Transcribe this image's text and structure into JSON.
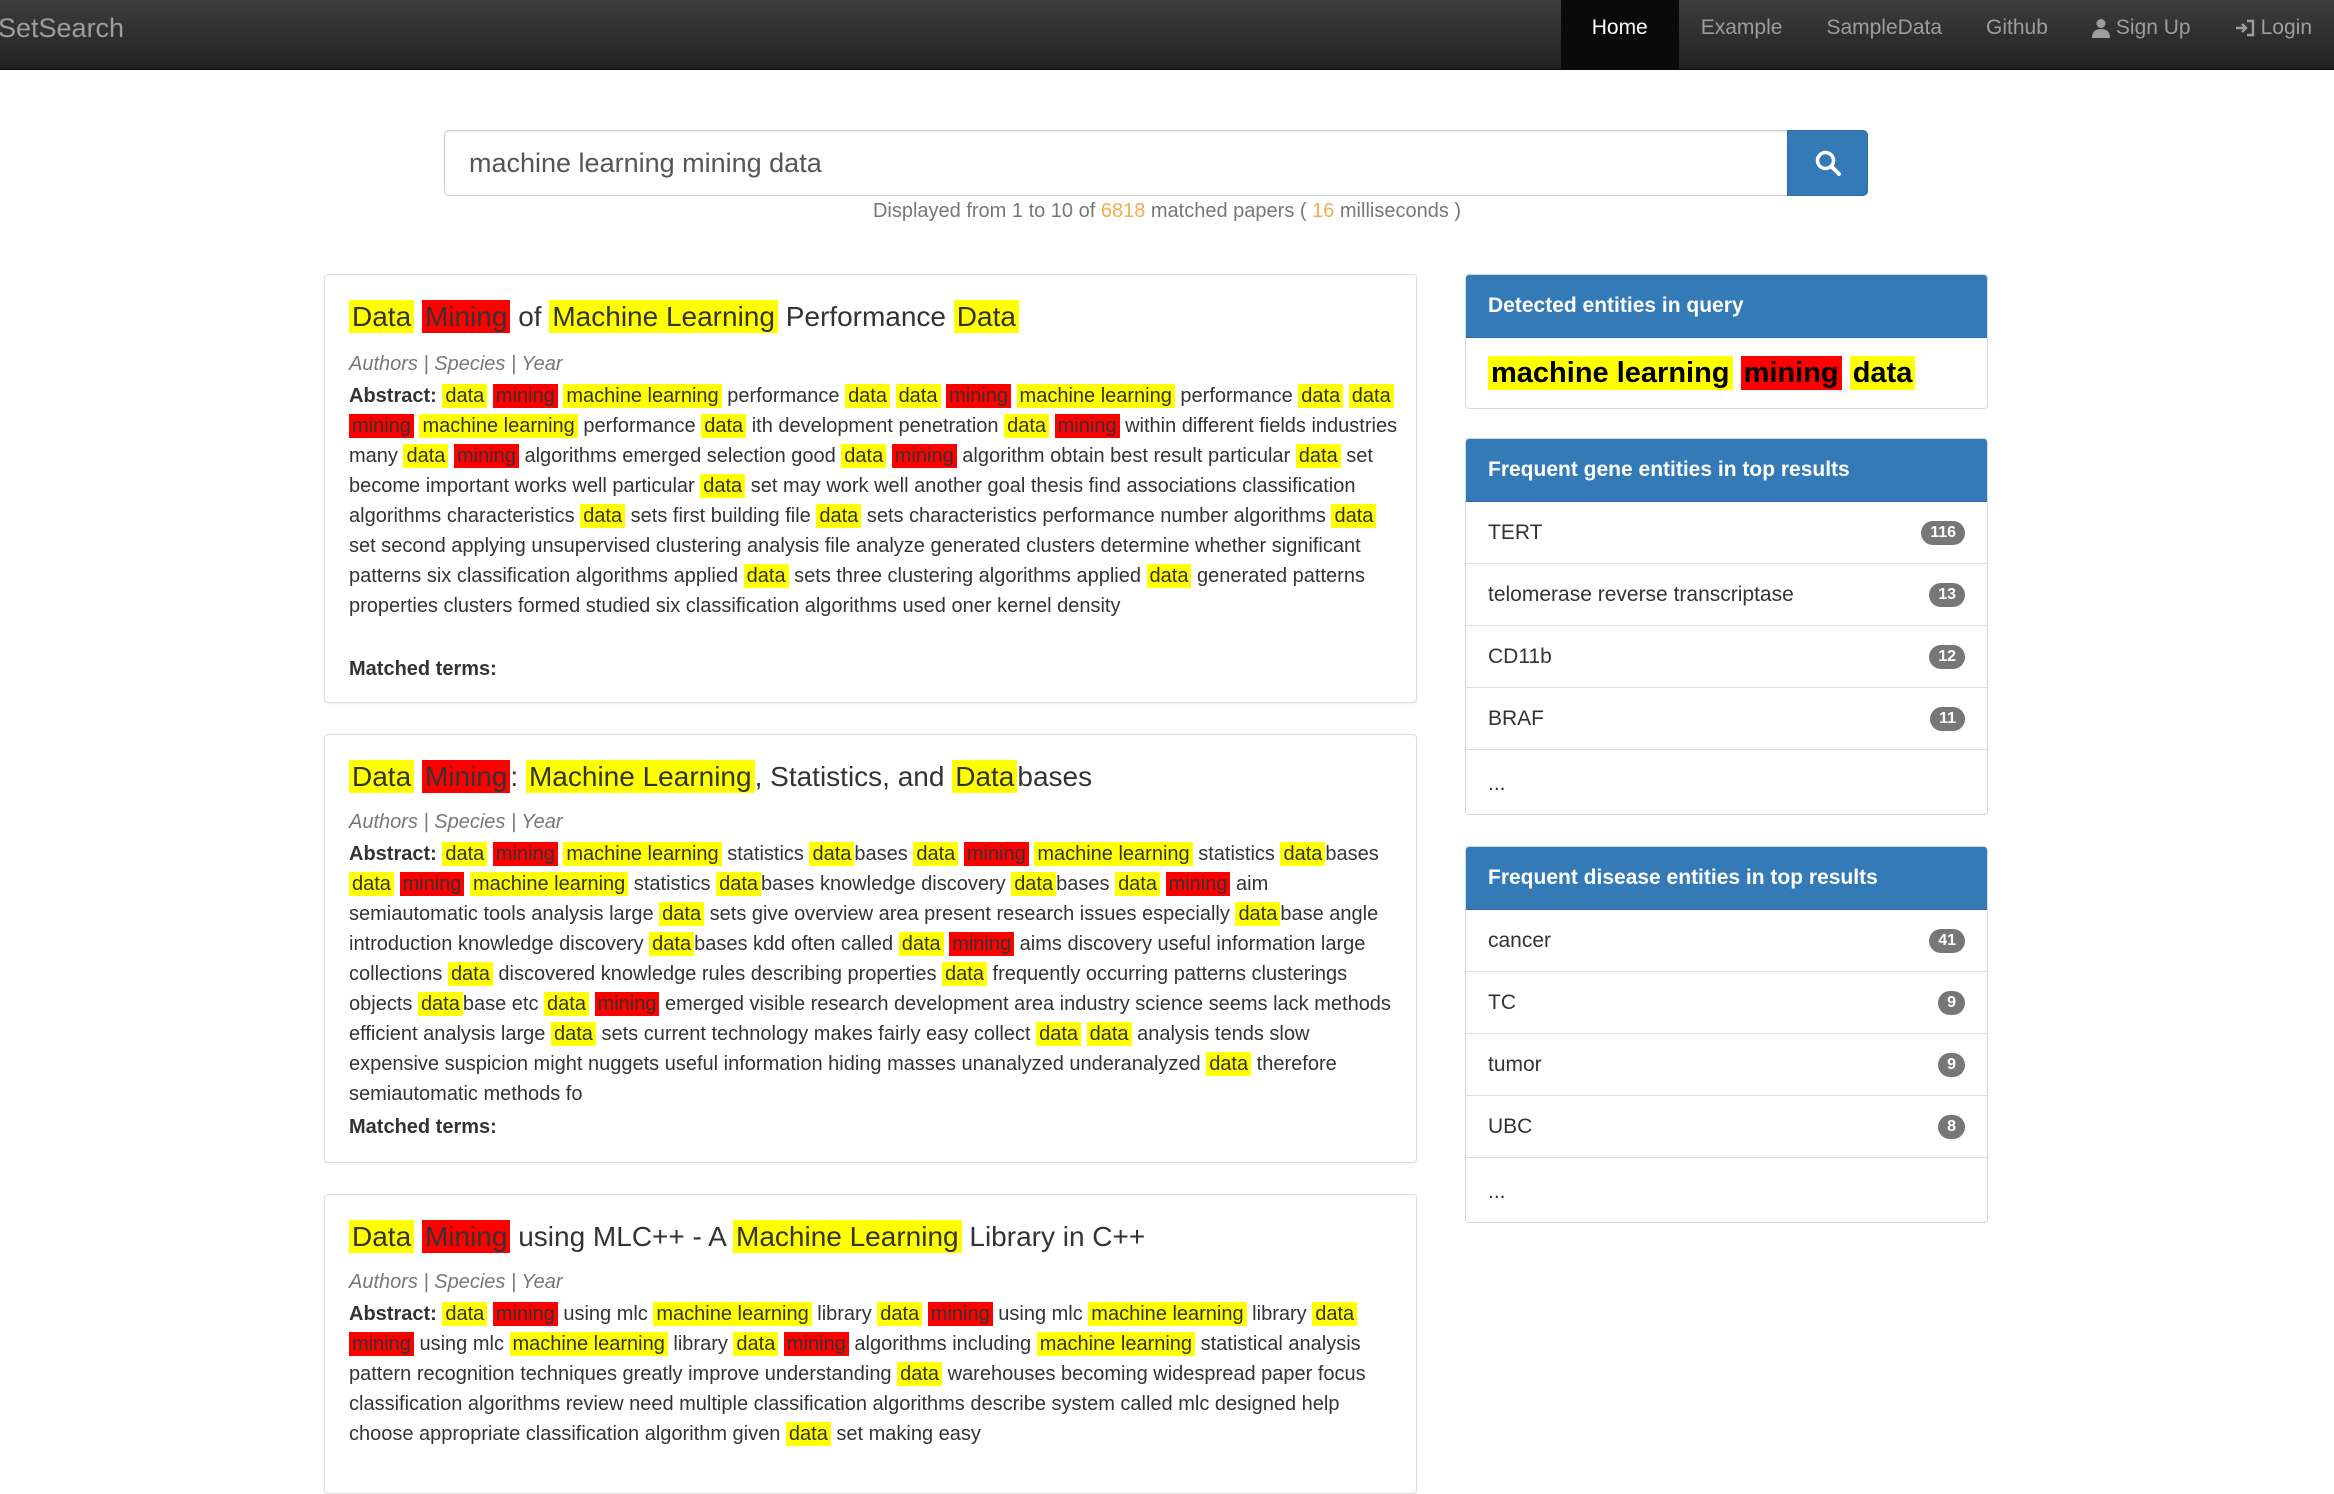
{
  "nav": {
    "brand": "SetSearch",
    "items": [
      {
        "label": "Home",
        "active": true
      },
      {
        "label": "Example"
      },
      {
        "label": "SampleData"
      },
      {
        "label": "Github"
      },
      {
        "label": "Sign Up",
        "icon": "user-icon"
      },
      {
        "label": "Login",
        "icon": "login-icon"
      }
    ]
  },
  "search": {
    "query": "machine learning mining data",
    "info_prefix": "Displayed from 1 to 10 of ",
    "total": "6818",
    "info_mid": " matched papers ( ",
    "ms": "16",
    "info_suffix": " milliseconds )"
  },
  "results": [
    {
      "title": "Data Mining of Machine Learning Performance Data",
      "meta": "Authors | Species | Year",
      "abstract_label": "Abstract:",
      "abstract": "data mining machine learning performance data data mining machine learning performance data data mining machine learning performance data ith development penetration data mining within different fields industries many data mining algorithms emerged selection good data mining algorithm obtain best result particular data set become important works well particular data set may work well another goal thesis find associations classification algorithms characteristics data sets first building file data sets characteristics performance number algorithms data set second applying unsupervised clustering analysis file analyze generated clusters determine whether significant patterns six classification algorithms applied data sets three clustering algorithms applied data generated patterns properties clusters formed studied six classification algorithms used oner kernel density",
      "matched_label": "Matched terms:"
    },
    {
      "title": "Data Mining: Machine Learning, Statistics, and Databases",
      "meta": "Authors | Species | Year",
      "abstract_label": "Abstract:",
      "abstract": "data mining machine learning statistics databases data mining machine learning statistics databases data mining machine learning statistics databases knowledge discovery databases data mining aim semiautomatic tools analysis large data sets give overview area present research issues especially database angle introduction knowledge discovery databases kdd often called data mining aims discovery useful information large collections data discovered knowledge rules describing properties data frequently occurring patterns clusterings objects database etc data mining emerged visible research development area industry science seems lack methods efficient analysis large data sets current technology makes fairly easy collect data data analysis tends slow expensive suspicion might nuggets useful information hiding masses unanalyzed underanalyzed data therefore semiautomatic methods fo",
      "matched_label": "Matched terms:"
    },
    {
      "title": "Data Mining using MLC++ - A Machine Learning Library in C++",
      "meta": "Authors | Species | Year",
      "abstract_label": "Abstract:",
      "abstract": "data mining using mlc machine learning library data mining using mlc machine learning library data mining using mlc machine learning library data mining algorithms including machine learning statistical analysis pattern recognition techniques greatly improve understanding data warehouses becoming widespread paper focus classification algorithms review need multiple classification algorithms describe system called mlc designed help choose appropriate classification algorithm given data set making easy",
      "matched_label": "Matched terms:"
    }
  ],
  "sidebar": {
    "query_entities": {
      "heading": "Detected entities in query",
      "terms": [
        {
          "text": "machine learning",
          "color": "#ffff00"
        },
        {
          "text": "mining",
          "color": "#ff0000"
        },
        {
          "text": "data",
          "color": "#ffff00"
        }
      ]
    },
    "genes": {
      "heading": "Frequent gene entities in top results",
      "items": [
        {
          "label": "TERT",
          "count": "116"
        },
        {
          "label": "telomerase reverse transcriptase",
          "count": "13"
        },
        {
          "label": "CD11b",
          "count": "12"
        },
        {
          "label": "BRAF",
          "count": "11"
        },
        {
          "label": "..."
        }
      ]
    },
    "diseases": {
      "heading": "Frequent disease entities in top results",
      "items": [
        {
          "label": "cancer",
          "count": "41"
        },
        {
          "label": "TC",
          "count": "9"
        },
        {
          "label": "tumor",
          "count": "9"
        },
        {
          "label": "UBC",
          "count": "8"
        },
        {
          "label": "..."
        }
      ]
    }
  },
  "colors": {
    "accent": "#337ab7",
    "highlight_yellow": "#ffff00",
    "highlight_red": "#ff0000",
    "count_orange": "#f0ad4e"
  }
}
